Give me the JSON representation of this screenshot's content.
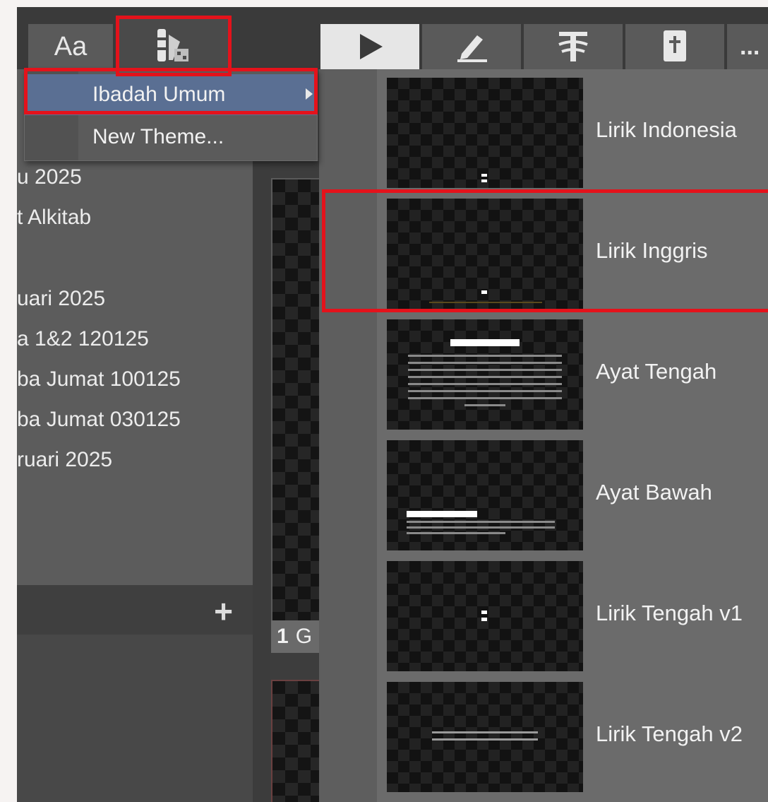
{
  "toolbar": {
    "font_tab_label": "Aa",
    "themes_icon": "theme-palette-icon"
  },
  "dropdown": {
    "items": [
      {
        "label": "Ibadah Umum",
        "has_submenu": true
      },
      {
        "label": "New Theme...",
        "has_submenu": false
      }
    ]
  },
  "left_list": {
    "items": [
      "u 2025",
      "t Alkitab",
      "uari 2025",
      "a 1&2 120125",
      "ba Jumat 100125",
      "ba Jumat 030125",
      "ruari 2025"
    ],
    "add_icon": "+"
  },
  "middle": {
    "slide_number": "1",
    "slide_label": "G"
  },
  "right_toolbar": {
    "buttons": [
      "play-icon",
      "pencil-icon",
      "text-style-icon",
      "bible-icon",
      "more-icon"
    ],
    "more_label": "..."
  },
  "themes": {
    "items": [
      {
        "name": "Lirik Indonesia"
      },
      {
        "name": "Lirik Inggris"
      },
      {
        "name": "Ayat Tengah"
      },
      {
        "name": "Ayat Bawah"
      },
      {
        "name": "Lirik Tengah v1"
      },
      {
        "name": "Lirik Tengah v2"
      }
    ]
  },
  "colors": {
    "highlight": "#5a6f93",
    "annotation_red": "#e4121b"
  }
}
